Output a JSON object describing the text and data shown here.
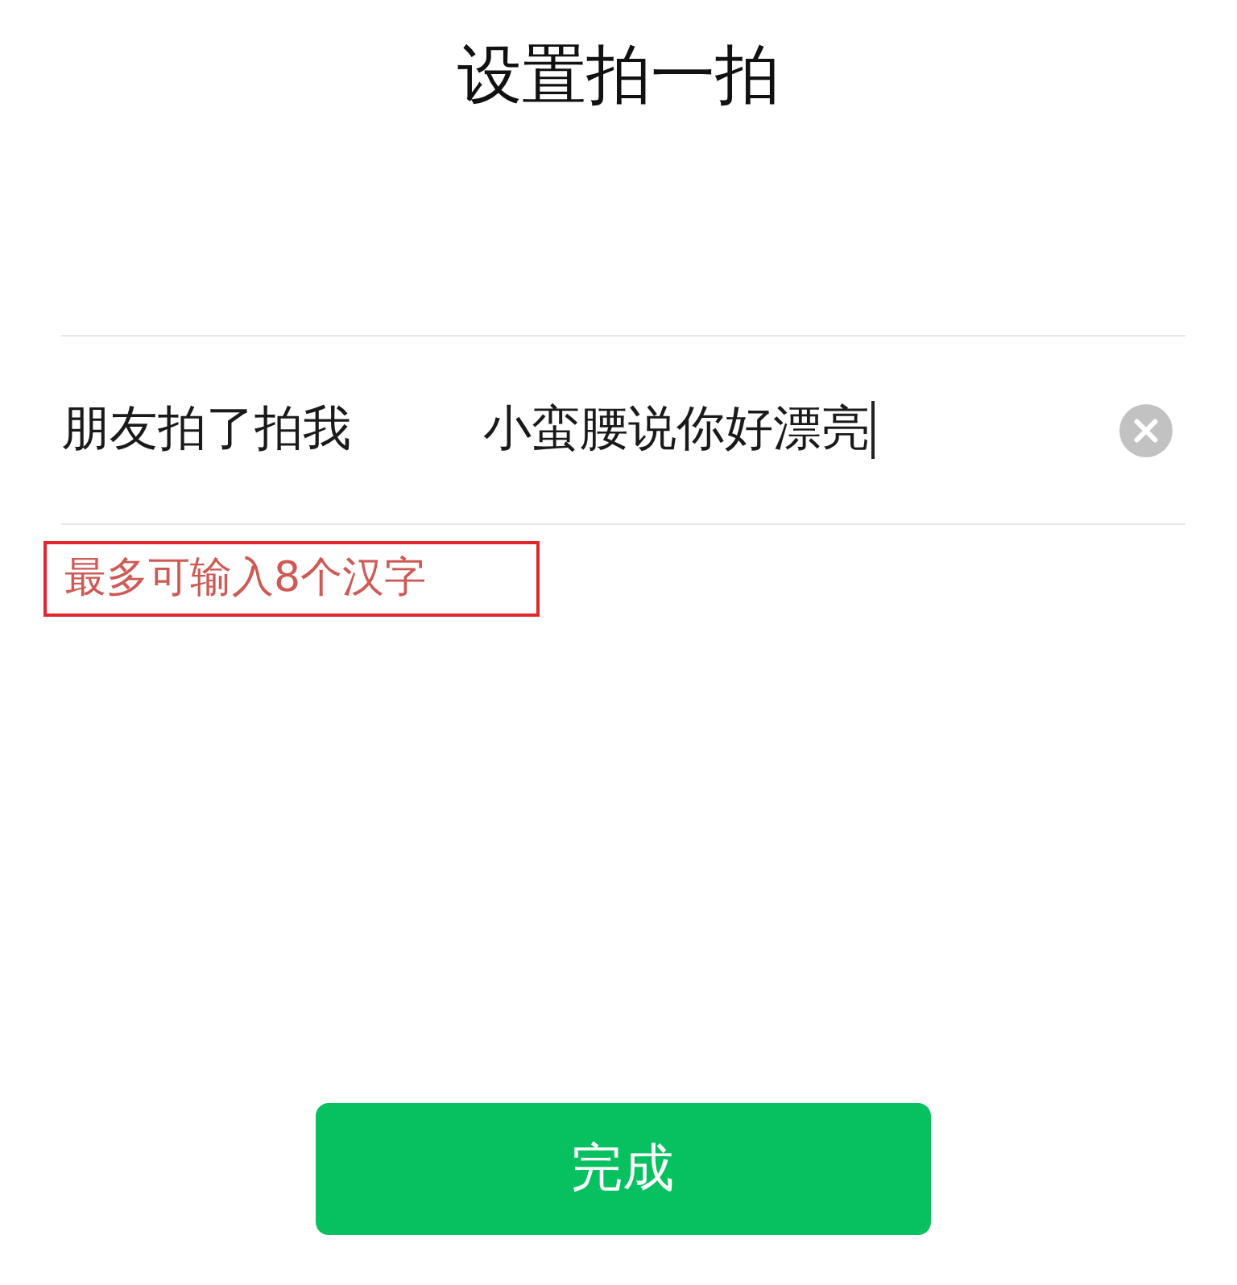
{
  "title": "设置拍一拍",
  "field": {
    "label": "朋友拍了拍我",
    "value": "小蛮腰说你好漂亮",
    "focused": true
  },
  "hint": {
    "text": "最多可输入8个汉字",
    "highlighted": true
  },
  "buttons": [
    {
      "label": "完成",
      "kind": "primary"
    }
  ]
}
